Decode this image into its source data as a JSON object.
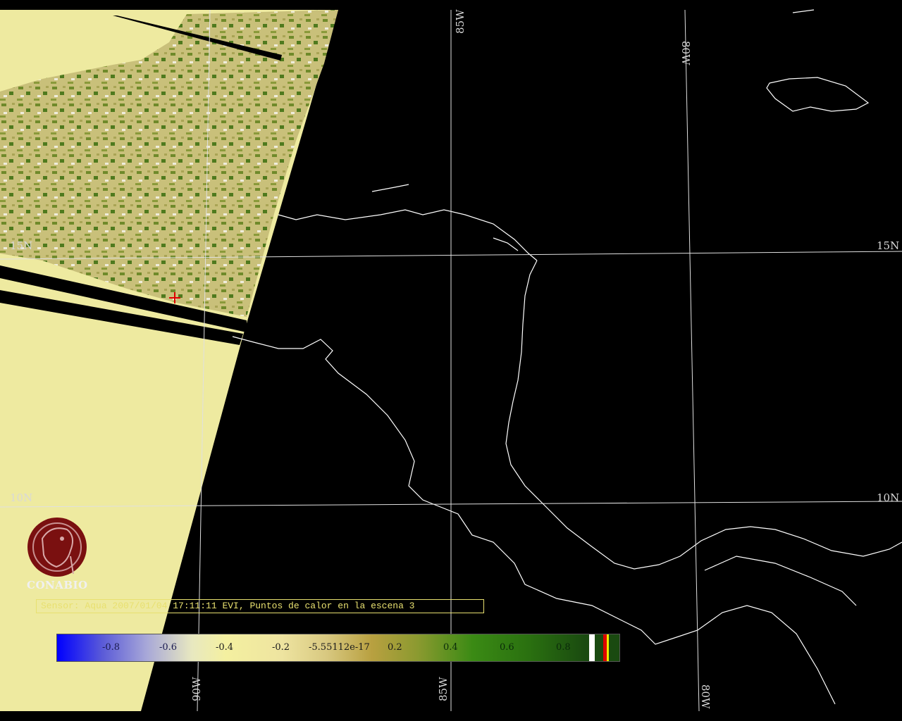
{
  "map": {
    "grid_labels": {
      "lon_top": [
        "85W",
        "80W"
      ],
      "lon_bottom": [
        "90W",
        "85W",
        "80W"
      ],
      "lat_left": [
        "15N",
        "10N"
      ],
      "lat_right": [
        "15N",
        "10N"
      ]
    },
    "marker": "hotspot-cross"
  },
  "logo": {
    "text": "CONABIO",
    "icon": "conabio-macaw-logo-icon"
  },
  "caption": {
    "text": "Sensor: Aqua 2007/01/04 17:11:11 EVI, Puntos de calor en la escena 3"
  },
  "colorbar": {
    "ticks": [
      "-0.8",
      "-0.6",
      "-0.4",
      "-0.2",
      "-5.55112e-17",
      "0.2",
      "0.4",
      "0.6",
      "0.8"
    ],
    "colors": {
      "low": "#0000ff",
      "mid": "#f4f0a0",
      "high": "#1a4a10",
      "swath": "#eeeaa0",
      "coast": "#ffffff",
      "caption": "#e8e070"
    }
  }
}
